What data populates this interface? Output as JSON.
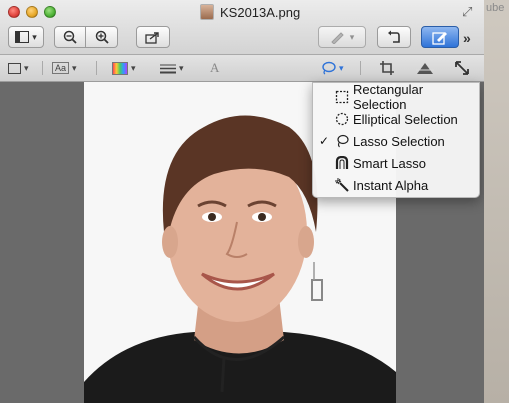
{
  "window": {
    "title": "KS2013A.png"
  },
  "desktop": {
    "partial_text": "ube"
  },
  "toolbar": {
    "more_label": "»",
    "sidebar_button": {
      "icon": "sidebar-icon",
      "arrow": "▾"
    },
    "zoom_out": {
      "icon": "zoom-out-icon"
    },
    "zoom_in": {
      "icon": "zoom-in-icon"
    },
    "share": {
      "icon": "share-icon"
    },
    "annotate": {
      "icon": "annotate-pen-icon",
      "arrow": "▾"
    },
    "rotate": {
      "icon": "rotate-icon"
    },
    "edit": {
      "icon": "edit-pencil-icon",
      "active": true
    }
  },
  "edit_toolbar": {
    "shapes": {
      "icon": "rectangle-shape-icon",
      "arrow": "▾"
    },
    "text": {
      "label": "Aa",
      "arrow": "▾"
    },
    "color": {
      "icon": "color-swatch-icon",
      "arrow": "▾"
    },
    "lines": {
      "icon": "line-style-icon",
      "arrow": "▾"
    },
    "font": {
      "label": "A"
    },
    "selection": {
      "icon": "lasso-icon",
      "arrow": "▾"
    },
    "crop": {
      "icon": "crop-icon"
    },
    "adjust": {
      "icon": "adjust-color-icon"
    },
    "resize": {
      "icon": "resize-icon"
    }
  },
  "selection_menu": {
    "items": [
      {
        "label": "Rectangular Selection",
        "icon": "rectangular-selection-icon",
        "checked": false
      },
      {
        "label": "Elliptical Selection",
        "icon": "elliptical-selection-icon",
        "checked": false
      },
      {
        "label": "Lasso Selection",
        "icon": "lasso-selection-icon",
        "checked": true
      },
      {
        "label": "Smart Lasso",
        "icon": "smart-lasso-icon",
        "checked": false
      },
      {
        "label": "Instant Alpha",
        "icon": "instant-alpha-icon",
        "checked": false
      }
    ],
    "check_mark": "✓"
  },
  "colors": {
    "accent": "#2f73d8",
    "canvas": "#6a6a6a"
  }
}
